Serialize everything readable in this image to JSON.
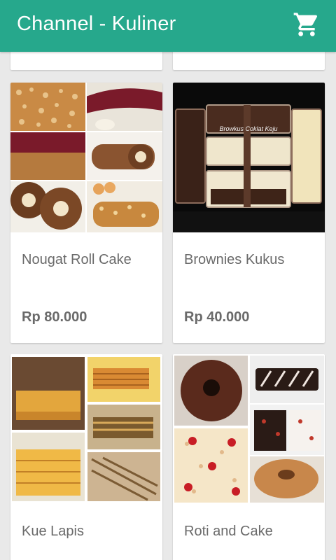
{
  "appbar": {
    "title": "Channel - Kuliner",
    "cart_icon": "cart-icon",
    "background": "#26a88c"
  },
  "products": [
    {
      "name": "Nougat Roll Cake",
      "price": "Rp 80.000"
    },
    {
      "name": "Brownies Kukus",
      "price": "Rp 40.000"
    },
    {
      "name": "Kue Lapis",
      "price": ""
    },
    {
      "name": "Roti and Cake",
      "price": ""
    }
  ],
  "images": {
    "brownies_label": "Browkus Coklat Keju"
  }
}
